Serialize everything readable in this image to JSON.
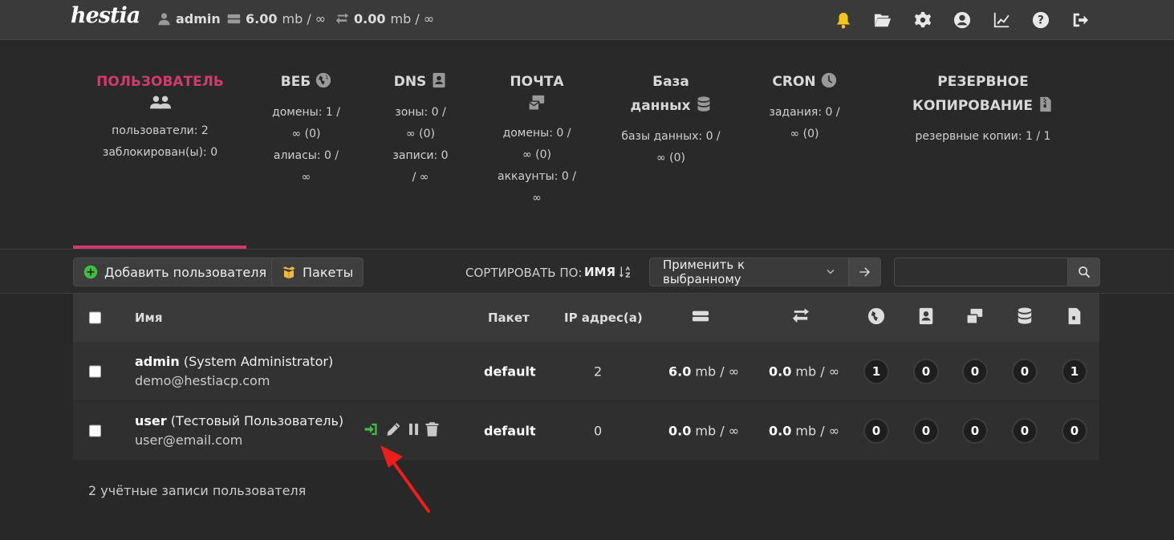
{
  "header": {
    "logo": "hestia",
    "user": "admin",
    "disk": {
      "value": "6.00",
      "unit": "mb / ∞"
    },
    "bandwidth": {
      "value": "0.00",
      "unit": "mb / ∞"
    }
  },
  "tabs": [
    {
      "title": "ПОЛЬЗОВАТЕЛЬ",
      "stats": [
        "пользователи: 2",
        "заблокирован(ы): 0"
      ],
      "active": true
    },
    {
      "title": "ВЕБ",
      "stats": [
        "домены: 1 /",
        "∞ (0)",
        "алиасы: 0 /",
        "∞"
      ]
    },
    {
      "title": "DNS",
      "stats": [
        "зоны: 0 /",
        "∞ (0)",
        "записи: 0",
        "/ ∞"
      ]
    },
    {
      "title": "ПОЧТА",
      "stats": [
        "домены: 0 /",
        "∞ (0)",
        "аккаунты: 0 /",
        "∞"
      ]
    },
    {
      "title_lines": [
        "База",
        "данных"
      ],
      "stats": [
        "базы данных: 0 /",
        "∞ (0)"
      ]
    },
    {
      "title": "CRON",
      "stats": [
        "задания: 0 /",
        "∞ (0)"
      ]
    },
    {
      "title_lines": [
        "РЕЗЕРВНОЕ",
        "КОПИРОВАНИЕ"
      ],
      "stats": [
        "резервные копии: 1 / 1"
      ]
    }
  ],
  "toolbar": {
    "add_user": "Добавить пользователя",
    "packages": "Пакеты",
    "sort_label": "СОРТИРОВАТЬ ПО:",
    "sort_value": "ИМЯ",
    "apply_select": "Применить к выбранному",
    "search_placeholder": ""
  },
  "table": {
    "headers": {
      "name": "Имя",
      "package": "Пакет",
      "ip": "IP адрес(а)"
    },
    "rows": [
      {
        "username": "admin",
        "fullname": " (System Administrator)",
        "email": "demo@hestiacp.com",
        "package": "default",
        "ip": "2",
        "disk": "6.0",
        "disk_unit": " mb / ∞",
        "bw": "0.0",
        "bw_unit": " mb / ∞",
        "counts": [
          "1",
          "0",
          "0",
          "0",
          "1"
        ]
      },
      {
        "username": "user",
        "fullname": " (Тестовый Пользователь)",
        "email": "user@email.com",
        "package": "default",
        "ip": "0",
        "disk": "0.0",
        "disk_unit": " mb / ∞",
        "bw": "0.0",
        "bw_unit": " mb / ∞",
        "counts": [
          "0",
          "0",
          "0",
          "0",
          "0"
        ]
      }
    ]
  },
  "footer": "2 учётные записи пользователя",
  "colors": {
    "accent": "#d03a6e",
    "login_green": "#3fbf3f",
    "bell": "#f5c518",
    "annotation_arrow": "#ee1c1c"
  }
}
